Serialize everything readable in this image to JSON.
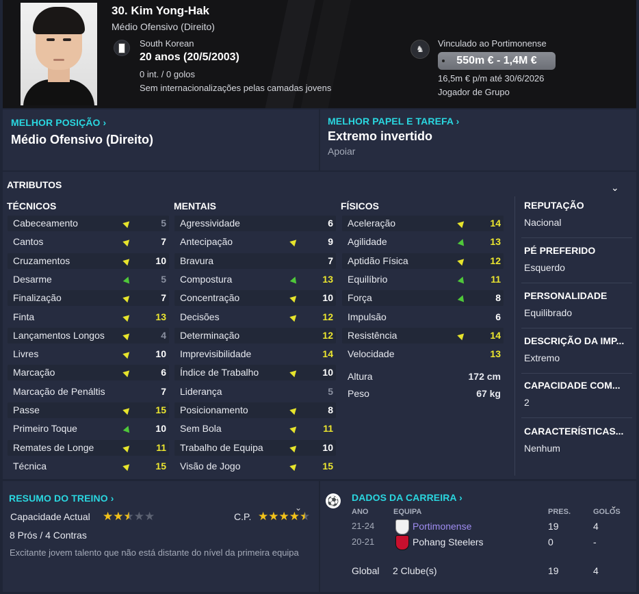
{
  "header": {
    "name": "30. Kim Yong-Hak",
    "position": "Médio Ofensivo (Direito)",
    "nationality": "South Korean",
    "age": "20 anos (20/5/2003)",
    "caps": "0 int. / 0 golos",
    "youth_caps": "Sem internacionalizações pelas camadas jovens",
    "contract_club": "Vinculado ao Portimonense",
    "value": "550m € - 1,4M €",
    "wage": "16,5m € p/m até 30/6/2026",
    "squad_status": "Jogador de Grupo"
  },
  "best_position": {
    "link": "MELHOR POSIÇÃO",
    "value": "Médio Ofensivo (Direito)"
  },
  "best_role": {
    "link": "MELHOR PAPEL E TAREFA",
    "value": "Extremo invertido",
    "duty": "Apoiar"
  },
  "attributes": {
    "title": "ATRIBUTOS",
    "technical": {
      "title": "TÉCNICOS",
      "rows": [
        {
          "label": "Cabeceamento",
          "value": "5",
          "trend": "up",
          "tone": "grey"
        },
        {
          "label": "Cantos",
          "value": "7",
          "trend": "up",
          "tone": "white"
        },
        {
          "label": "Cruzamentos",
          "value": "10",
          "trend": "up",
          "tone": "white"
        },
        {
          "label": "Desarme",
          "value": "5",
          "trend": "up-strong",
          "tone": "grey"
        },
        {
          "label": "Finalização",
          "value": "7",
          "trend": "up",
          "tone": "white"
        },
        {
          "label": "Finta",
          "value": "13",
          "trend": "up",
          "tone": "yellow"
        },
        {
          "label": "Lançamentos Longos",
          "value": "4",
          "trend": "up",
          "tone": "grey"
        },
        {
          "label": "Livres",
          "value": "10",
          "trend": "up",
          "tone": "white"
        },
        {
          "label": "Marcação",
          "value": "6",
          "trend": "up",
          "tone": "white"
        },
        {
          "label": "Marcação de Penáltis",
          "value": "7",
          "trend": "",
          "tone": "white"
        },
        {
          "label": "Passe",
          "value": "15",
          "trend": "up",
          "tone": "yellow"
        },
        {
          "label": "Primeiro Toque",
          "value": "10",
          "trend": "up-strong",
          "tone": "white"
        },
        {
          "label": "Remates de Longe",
          "value": "11",
          "trend": "up",
          "tone": "yellow"
        },
        {
          "label": "Técnica",
          "value": "15",
          "trend": "up",
          "tone": "yellow"
        }
      ]
    },
    "mental": {
      "title": "MENTAIS",
      "rows": [
        {
          "label": "Agressividade",
          "value": "6",
          "trend": "",
          "tone": "white"
        },
        {
          "label": "Antecipação",
          "value": "9",
          "trend": "up",
          "tone": "white"
        },
        {
          "label": "Bravura",
          "value": "7",
          "trend": "",
          "tone": "white"
        },
        {
          "label": "Compostura",
          "value": "13",
          "trend": "up-strong",
          "tone": "yellow"
        },
        {
          "label": "Concentração",
          "value": "10",
          "trend": "up",
          "tone": "white"
        },
        {
          "label": "Decisões",
          "value": "12",
          "trend": "up",
          "tone": "yellow"
        },
        {
          "label": "Determinação",
          "value": "12",
          "trend": "",
          "tone": "yellow"
        },
        {
          "label": "Imprevisibilidade",
          "value": "14",
          "trend": "",
          "tone": "yellow"
        },
        {
          "label": "Índice de Trabalho",
          "value": "10",
          "trend": "up",
          "tone": "white"
        },
        {
          "label": "Liderança",
          "value": "5",
          "trend": "",
          "tone": "grey"
        },
        {
          "label": "Posicionamento",
          "value": "8",
          "trend": "up",
          "tone": "white"
        },
        {
          "label": "Sem Bola",
          "value": "11",
          "trend": "up",
          "tone": "yellow"
        },
        {
          "label": "Trabalho de Equipa",
          "value": "10",
          "trend": "up",
          "tone": "white"
        },
        {
          "label": "Visão de Jogo",
          "value": "15",
          "trend": "up",
          "tone": "yellow"
        }
      ]
    },
    "physical": {
      "title": "FÍSICOS",
      "rows": [
        {
          "label": "Aceleração",
          "value": "14",
          "trend": "up",
          "tone": "yellow"
        },
        {
          "label": "Agilidade",
          "value": "13",
          "trend": "up-strong",
          "tone": "yellow"
        },
        {
          "label": "Aptidão Física",
          "value": "12",
          "trend": "up",
          "tone": "yellow"
        },
        {
          "label": "Equilíbrio",
          "value": "11",
          "trend": "up-strong",
          "tone": "yellow"
        },
        {
          "label": "Força",
          "value": "8",
          "trend": "up-strong",
          "tone": "white"
        },
        {
          "label": "Impulsão",
          "value": "6",
          "trend": "",
          "tone": "white"
        },
        {
          "label": "Resistência",
          "value": "14",
          "trend": "up",
          "tone": "yellow"
        },
        {
          "label": "Velocidade",
          "value": "13",
          "trend": "",
          "tone": "yellow"
        }
      ],
      "height_label": "Altura",
      "height": "172 cm",
      "weight_label": "Peso",
      "weight": "67 kg"
    }
  },
  "side": [
    {
      "title": "REPUTAÇÃO",
      "value": "Nacional"
    },
    {
      "title": "PÉ PREFERIDO",
      "value": "Esquerdo"
    },
    {
      "title": "PERSONALIDADE",
      "value": "Equilibrado"
    },
    {
      "title": "DESCRIÇÃO DA IMP...",
      "value": "Extremo"
    },
    {
      "title": "CAPACIDADE COM...",
      "value": "2"
    },
    {
      "title": "CARACTERÍSTICAS...",
      "value": "Nenhum"
    }
  ],
  "training": {
    "link": "RESUMO DO TREINO",
    "current_ability_label": "Capacidade Actual",
    "current_ability_stars": 2.5,
    "potential_label": "C.P.",
    "potential_stars": 4.5,
    "pros_cons": "8 Prós / 4 Contras",
    "description": "Excitante jovem talento que não está distante do nível da primeira equipa"
  },
  "career": {
    "link": "DADOS DA CARREIRA",
    "columns": {
      "year": "ANO",
      "team": "EQUIPA",
      "apps": "PRES.",
      "goals": "GOLOS"
    },
    "rows": [
      {
        "year": "21-24",
        "team": "Portimonense",
        "apps": "19",
        "goals": "4"
      },
      {
        "year": "20-21",
        "team": "Pohang Steelers",
        "apps": "0",
        "goals": "-"
      }
    ],
    "total": {
      "label": "Global",
      "team": "2 Clube(s)",
      "apps": "19",
      "goals": "4"
    }
  },
  "colors": {
    "accent_link": "#2ad7e0",
    "value_yellow": "#ece62f",
    "trend_yellow": "#e6e42c",
    "trend_green": "#4fc83a",
    "club_link": "#9f8cf0"
  }
}
